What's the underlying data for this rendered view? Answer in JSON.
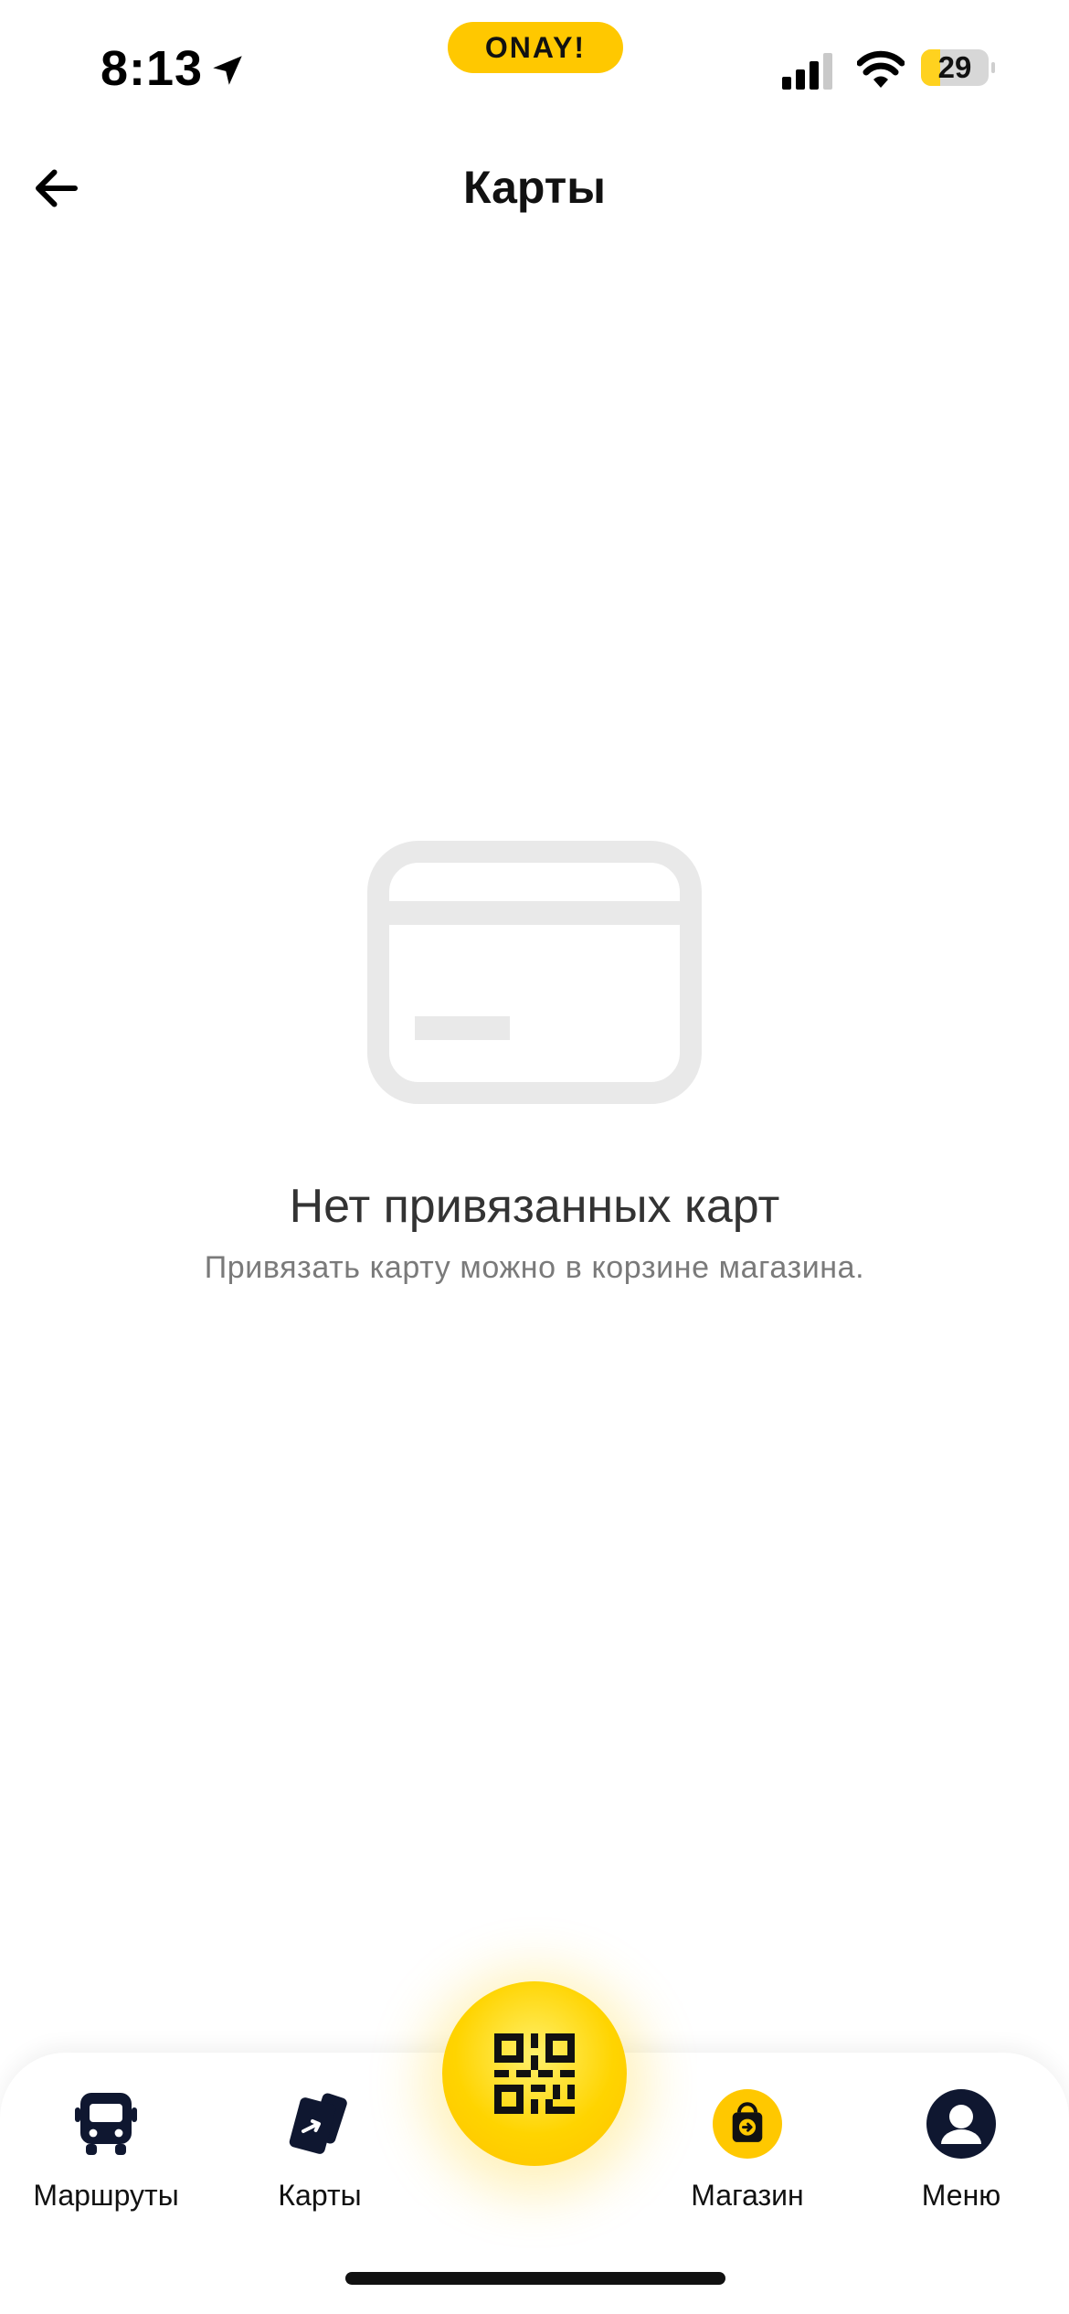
{
  "status_bar": {
    "time": "8:13",
    "brand": "ONAY!",
    "battery_level": 29,
    "battery_text": "29"
  },
  "header": {
    "title": "Карты"
  },
  "empty_state": {
    "title": "Нет привязанных карт",
    "subtitle": "Привязать карту можно в корзине магазина."
  },
  "tab_bar": {
    "items": [
      {
        "label": "Маршруты",
        "icon": "bus-icon"
      },
      {
        "label": "Карты",
        "icon": "cards-icon"
      },
      {
        "label": "",
        "icon": "qr-code-icon"
      },
      {
        "label": "Магазин",
        "icon": "shopping-bag-icon"
      },
      {
        "label": "Меню",
        "icon": "user-profile-icon"
      }
    ]
  },
  "colors": {
    "accent": "#FFC800",
    "text_primary": "#111111",
    "text_secondary": "#7A7A7A",
    "empty_icon": "#E9E9E9"
  }
}
